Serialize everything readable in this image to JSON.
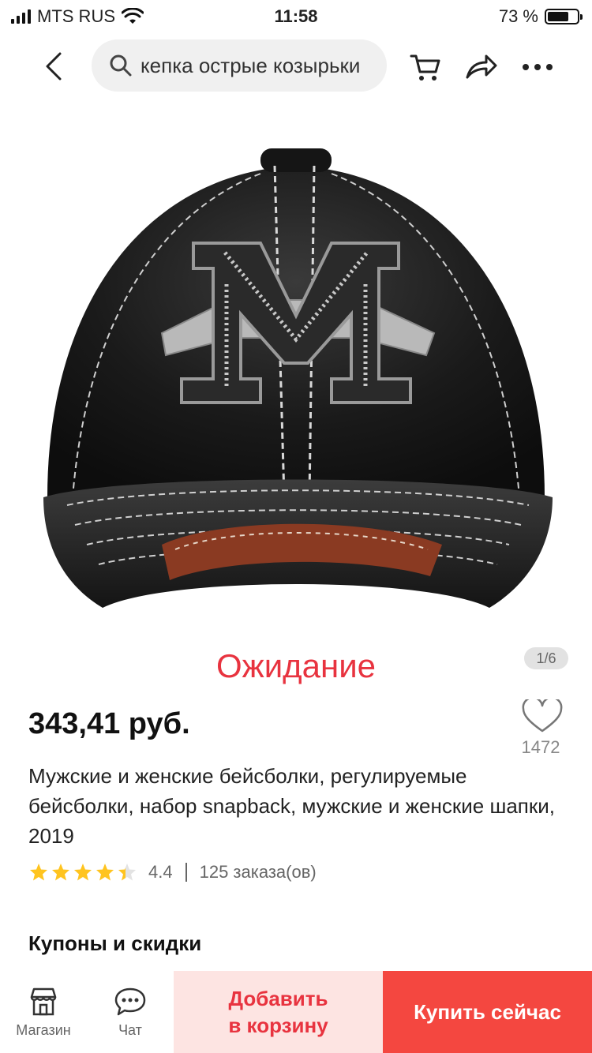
{
  "status_bar": {
    "carrier": "MTS RUS",
    "time": "11:58",
    "battery": "73 %",
    "battery_level": 0.73
  },
  "nav": {
    "search_query": "кепка острые козырьки",
    "icons": [
      "back-icon",
      "search-icon",
      "cart-icon",
      "share-icon",
      "more-icon"
    ]
  },
  "gallery": {
    "overlay_text": "Ожидание",
    "page_indicator": "1/6"
  },
  "product": {
    "price": "343,41 руб.",
    "wishlist_count": "1472",
    "title": "Мужские и женские бейсболки, регулируемые бейсболки, набор snapback, мужские и женские шапки, 2019",
    "rating": "4.4",
    "rating_value": 4.4,
    "orders": "125 заказа(ов)"
  },
  "sections": {
    "coupons_title": "Купоны и скидки"
  },
  "bottom_bar": {
    "store_label": "Магазин",
    "chat_label": "Чат",
    "add_to_cart_line1": "Добавить",
    "add_to_cart_line2": "в корзину",
    "buy_now": "Купить сейчас"
  },
  "colors": {
    "accent": "#e8333f",
    "buy_button": "#f44740",
    "cart_button_bg": "#fde4e2",
    "star": "#ffc41f"
  }
}
